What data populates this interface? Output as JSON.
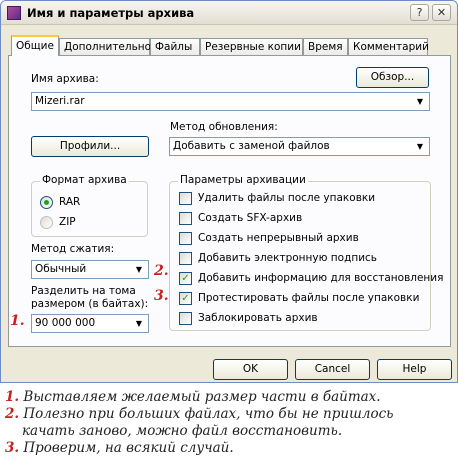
{
  "window": {
    "title": "Имя и параметры архива",
    "help_glyph": "?",
    "close_glyph": "✕"
  },
  "tabs": [
    {
      "label": "Общие",
      "active": true
    },
    {
      "label": "Дополнительно"
    },
    {
      "label": "Файлы"
    },
    {
      "label": "Резервные копии"
    },
    {
      "label": "Время"
    },
    {
      "label": "Комментарий"
    }
  ],
  "archive": {
    "name_label": "Имя архива:",
    "name_value": "Mizeri.rar",
    "browse_label": "Обзор..."
  },
  "profiles_label": "Профили...",
  "update": {
    "label": "Метод обновления:",
    "value": "Добавить с заменой файлов"
  },
  "format": {
    "legend": "Формат архива",
    "options": [
      {
        "label": "RAR",
        "selected": true
      },
      {
        "label": "ZIP",
        "selected": false
      }
    ]
  },
  "compression": {
    "label": "Метод сжатия:",
    "value": "Обычный"
  },
  "split": {
    "label_line1": "Разделить на тома",
    "label_line2": "размером (в байтах):",
    "value": "90 000 000"
  },
  "options": {
    "legend": "Параметры архивации",
    "items": [
      {
        "label": "Удалить файлы после упаковки",
        "checked": false
      },
      {
        "label": "Создать SFX-архив",
        "checked": false
      },
      {
        "label": "Создать непрерывный архив",
        "checked": false
      },
      {
        "label": "Добавить электронную подпись",
        "checked": false
      },
      {
        "label": "Добавить информацию для восстановления",
        "checked": true
      },
      {
        "label": "Протестировать файлы после упаковки",
        "checked": true
      },
      {
        "label": "Заблокировать архив",
        "checked": false
      }
    ]
  },
  "buttons": {
    "ok": "OK",
    "cancel": "Cancel",
    "help": "Help"
  },
  "markers": {
    "m1": "1.",
    "m2": "2.",
    "m3": "3."
  },
  "notes": [
    {
      "num": "1.",
      "text": "Выставляем желаемый размер части в байтах."
    },
    {
      "num": "2.",
      "text": "Полезно при больших файлах, что бы не пришлось"
    },
    {
      "num": "",
      "text": "качать заново, можно файл восстановить."
    },
    {
      "num": "3.",
      "text": "Проверим, на всякий случай."
    }
  ],
  "colors": {
    "accent_marker": "#c8201c",
    "check_green": "#21a121",
    "tab_highlight": "#ffc73c"
  },
  "icons": {
    "app": "winrar-books-icon",
    "dropdown": "chevron-down-icon"
  }
}
